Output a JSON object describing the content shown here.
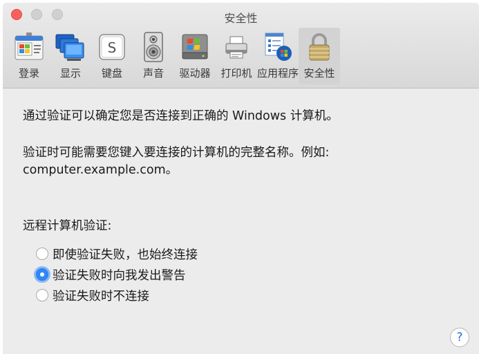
{
  "window": {
    "title": "安全性"
  },
  "toolbar": {
    "items": [
      {
        "label": "登录",
        "icon": "login-badge-icon",
        "selected": false
      },
      {
        "label": "显示",
        "icon": "display-icon",
        "selected": false
      },
      {
        "label": "键盘",
        "icon": "keyboard-icon",
        "selected": false
      },
      {
        "label": "声音",
        "icon": "speaker-icon",
        "selected": false
      },
      {
        "label": "驱动器",
        "icon": "drive-icon",
        "selected": false
      },
      {
        "label": "打印机",
        "icon": "printer-icon",
        "selected": false
      },
      {
        "label": "应用程序",
        "icon": "applications-icon",
        "selected": false
      },
      {
        "label": "安全性",
        "icon": "lock-icon",
        "selected": true
      }
    ],
    "keyboard_key": "S"
  },
  "content": {
    "intro": "通过验证可以确定您是否连接到正确的 Windows 计算机。",
    "instruction_line1": "验证时可能需要您键入要连接的计算机的完整名称。例如:",
    "instruction_line2": "computer.example.com。",
    "group_label": "远程计算机验证:",
    "options": [
      {
        "label": "即使验证失败，也始终连接",
        "checked": false
      },
      {
        "label": "验证失败时向我发出警告",
        "checked": true
      },
      {
        "label": "验证失败时不连接",
        "checked": false
      }
    ],
    "help_label": "?"
  },
  "colors": {
    "accent": "#2f87f8",
    "close_button": "#fc605c",
    "window_bg": "#ececec"
  }
}
